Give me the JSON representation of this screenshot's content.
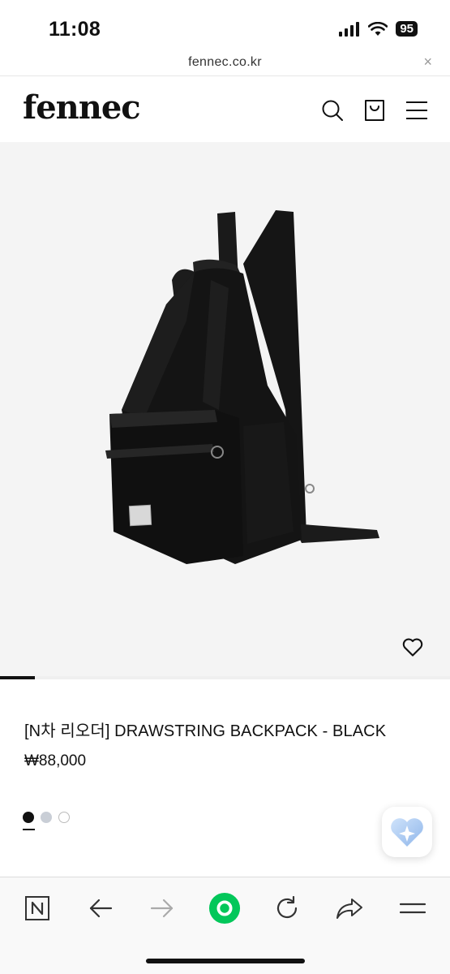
{
  "status_bar": {
    "time": "11:08",
    "battery": "95"
  },
  "url_bar": {
    "url": "fennec.co.kr",
    "close_label": "×"
  },
  "header": {
    "logo": "fennec"
  },
  "product": {
    "name": "[N차 리오더] DRAWSTRING BACKPACK - BLACK",
    "price": "₩88,000",
    "image_slide_position": 0.077
  },
  "colors": [
    {
      "name": "black",
      "hex": "#111111",
      "selected": true
    },
    {
      "name": "gray",
      "hex": "#c9ced6",
      "selected": false
    },
    {
      "name": "white",
      "hex": "#ffffff",
      "selected": false
    }
  ],
  "toolbar": {
    "items": [
      "naver-n-icon",
      "back-arrow-icon",
      "forward-arrow-icon",
      "green-circle-icon",
      "refresh-icon",
      "share-icon",
      "menu-icon"
    ],
    "accent": "#03c75a"
  }
}
